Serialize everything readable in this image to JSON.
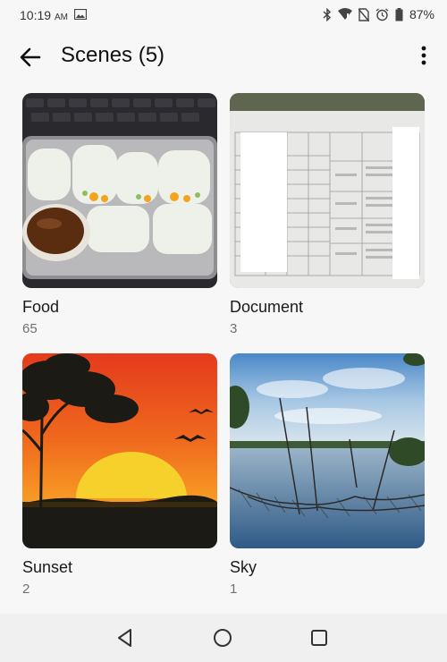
{
  "status_bar": {
    "time": "10:19",
    "ampm": "AM",
    "battery": "87%"
  },
  "app_bar": {
    "title": "Scenes (5)"
  },
  "scenes": [
    {
      "label": "Food",
      "count": "65"
    },
    {
      "label": "Document",
      "count": "3"
    },
    {
      "label": "Sunset",
      "count": "2"
    },
    {
      "label": "Sky",
      "count": "1"
    }
  ],
  "icons": {
    "back": "arrow-left-icon",
    "more": "more-vert-icon",
    "nav_back": "triangle-back-icon",
    "nav_home": "circle-home-icon",
    "nav_recents": "square-recents-icon"
  },
  "colors": {
    "background": "#f7f7f7",
    "count_text": "#707070"
  }
}
